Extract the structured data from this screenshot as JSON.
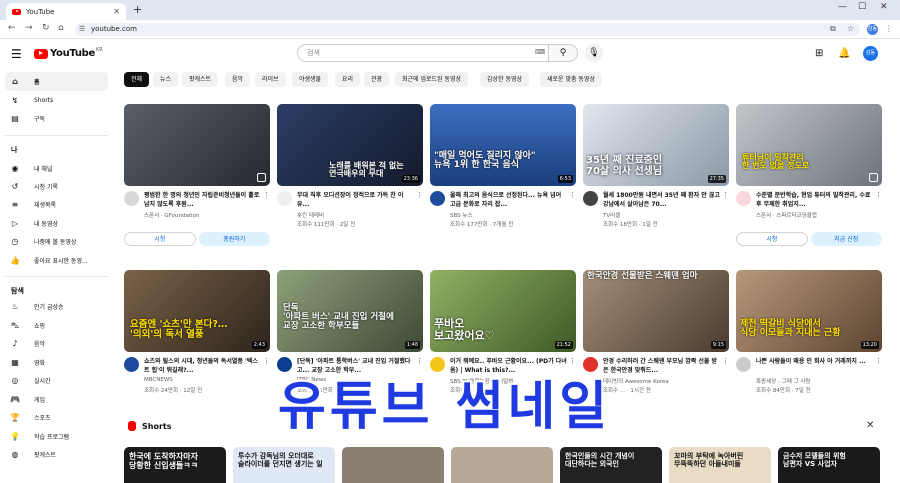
{
  "browser": {
    "tab_title": "YouTube",
    "url": "youtube.com",
    "profile_initial": "감동"
  },
  "header": {
    "logo_text": "YouTube",
    "logo_region": "KR",
    "search_placeholder": "검색",
    "avatar_text": "감동"
  },
  "sidebar": {
    "main": [
      {
        "label": "홈",
        "icon": "home-icon"
      },
      {
        "label": "Shorts",
        "icon": "shorts-icon"
      },
      {
        "label": "구독",
        "icon": "subscriptions-icon"
      }
    ],
    "you_header": "나",
    "you": [
      {
        "label": "내 채널",
        "icon": "channel-icon"
      },
      {
        "label": "시청 기록",
        "icon": "history-icon"
      },
      {
        "label": "재생목록",
        "icon": "playlist-icon"
      },
      {
        "label": "내 동영상",
        "icon": "video-icon"
      },
      {
        "label": "나중에 볼 동영상",
        "icon": "watch-later-icon"
      },
      {
        "label": "좋아요 표시한 동영...",
        "icon": "like-icon"
      }
    ],
    "explore_header": "탐색",
    "explore": [
      {
        "label": "인기 급상승",
        "icon": "trending-icon"
      },
      {
        "label": "쇼핑",
        "icon": "shopping-icon"
      },
      {
        "label": "음악",
        "icon": "music-icon"
      },
      {
        "label": "영화",
        "icon": "film-icon"
      },
      {
        "label": "실시간",
        "icon": "live-icon"
      },
      {
        "label": "게임",
        "icon": "gaming-icon"
      },
      {
        "label": "스포츠",
        "icon": "sports-icon"
      },
      {
        "label": "학습 프로그램",
        "icon": "learning-icon"
      },
      {
        "label": "팟캐스트",
        "icon": "podcast-icon"
      }
    ]
  },
  "chips": [
    "전체",
    "뉴스",
    "팟캐스트",
    "음악",
    "라이브",
    "야생생물",
    "요리",
    "관광",
    "최근에 업로드된 동영상",
    "감상한 동영상",
    "새로운 맞춤 동영상"
  ],
  "videos": [
    {
      "title": "평범한 한 명의 청년인 자립준비청년들이 홀로 남지 않도록 후원...",
      "channel": "스폰서 · GFoundation",
      "stats": "",
      "ad": true,
      "btn1": "시청",
      "btn2": "총원하기",
      "duration": "",
      "caption": "",
      "thumb_color": "#3a3f46"
    },
    {
      "title": "무대 직후 오디션장이 정적으로 가득 찬 이유...",
      "channel": "숏킨 테레비",
      "stats": "조회수 111만회 · 2일 전",
      "ad": false,
      "duration": "23:36",
      "caption": "노래를 배워본 적 없는\n연극배우의 무대",
      "thumb_color": "#1e2a44"
    },
    {
      "title": "올해 최고의 음식으로 선정된다... 뉴욕 넘어 고급 문화로 자리 잡...",
      "channel": "SBS 뉴스",
      "stats": "조회수 177만회 · 7개월 전",
      "ad": false,
      "duration": "6:53",
      "caption": "\"매일 먹어도 질리지 않아\"\n뉴욕 1위 한 한국 음식",
      "thumb_color": "#2f5fa8"
    },
    {
      "title": "월세 1800만원 내면서 35년 째 환자 안 끊고 강남에서 살아남은 70...",
      "channel": "TV러셀",
      "stats": "조회수 18만회 · 1일 전",
      "ad": false,
      "duration": "27:35",
      "caption": "35년 째 진료중인\n70살 의사 선생님",
      "thumb_color": "#c8d2dc"
    },
    {
      "title": "수준별 분반학습, 현업 튜터의 밀착관리, 수료 후 무제한 취업지...",
      "channel": "스폰서 · 스파르타코딩클럽",
      "stats": "",
      "ad": true,
      "btn1": "시청",
      "btn2": "지금 신청",
      "duration": "",
      "caption": "튜터님이 밀착관리\n한 번도 없을 정도로",
      "thumb_color": "#9aa0a8"
    },
    {
      "title": "쇼츠와 릴스의 시대, 청년들의 독서열풍 '텍스트 힙'이 뭐길래?...",
      "channel": "MBCNEWS",
      "stats": "조회수 24만회 · 12일 전",
      "ad": false,
      "duration": "2:43",
      "caption": "요즘엔 '쇼츠'만 본다?…\n'의외'의 독서 열풍",
      "thumb_color": "#4a3b2f"
    },
    {
      "title": "[단독] '아파트 통학버스' 교내 진입 거절했다고... 교장 고소한 학부...",
      "channel": "JTBC News",
      "stats": "조회수 1.1만회 · 1일 전",
      "ad": false,
      "duration": "1:48",
      "caption": "단독\n'아파트 버스' 교내 진입 거절에\n교장 고소한 학부모들",
      "thumb_color": "#5d6b50"
    },
    {
      "title": "이거 뭐예요.. 푸바오 근황이요... (PD가 다녀옴) | What is this?...",
      "channel": "SBS TV동물농장x애니멀봐",
      "stats": "조회수 ...",
      "ad": false,
      "duration": "21:52",
      "caption": "푸바오\n보고왔어요♡",
      "thumb_color": "#6a8b3e"
    },
    {
      "title": "안경 수리하러 간 스웨덴 부모님 깜짝 선물 받은 한국안경 맞춰드...",
      "channel": "데이빗의 Awesome Korea",
      "stats": "조회수 ... · 1시간 전",
      "ad": false,
      "duration": "9:15",
      "caption": "한국안경 선물받은 스웨덴 엄마",
      "thumb_color": "#7a6a58"
    },
    {
      "title": "나쁜 사람들이 왜응 인 회사 아 거래까지 ...",
      "channel": "특종세상 - 그때 그 사람",
      "stats": "조회수 84만회 · 7일 전",
      "ad": false,
      "duration": "13:20",
      "caption": "제천 떡갈비 식당에서\n식당 이모들과 지내는 근황",
      "thumb_color": "#8a6f52"
    }
  ],
  "shorts": {
    "title": "Shorts",
    "items": [
      {
        "caption": "한국에 도착하자마자\n당황한 신입생들ㅋㅋ",
        "bg": "#1c1c1c",
        "dark": false
      },
      {
        "caption": "투수가 감독님의 오더대로\n슬라이더를 던지면 생기는 일",
        "bg": "#dfe9f5",
        "dark": true
      },
      {
        "caption": "",
        "bg": "#8a8070",
        "dark": false
      },
      {
        "caption": "",
        "bg": "#b8a898",
        "dark": false
      },
      {
        "caption": "한국인들의 시간 개념이\n대단하다는 외국인",
        "bg": "#222",
        "dark": false
      },
      {
        "caption": "꼬마의 부탁에 녹아버린\n무뚝뚝하던 아들내미들",
        "bg": "#e8dcc4",
        "dark": true
      },
      {
        "caption": "금수저 모델들의 위험\n남편자 VS 사업자",
        "bg": "#1a1a1a",
        "dark": false
      }
    ]
  },
  "overlay": "유튜브 썸네일",
  "colors": {
    "brand_red": "#ff0000",
    "overlay_blue": "#1f3ae0",
    "link_blue": "#065fd4"
  }
}
